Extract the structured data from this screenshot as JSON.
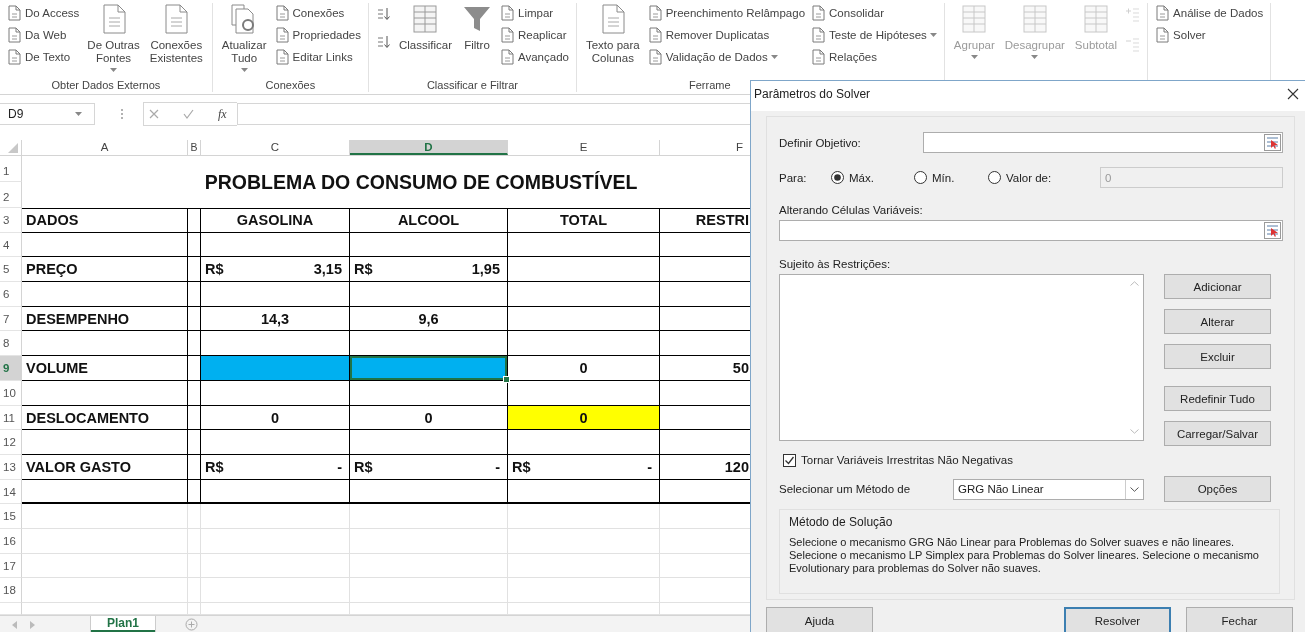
{
  "ribbon": {
    "groups": [
      {
        "label": "Obter Dados Externos",
        "controls": [
          {
            "kind": "stack",
            "disabled": false,
            "items": [
              {
                "label": "Do Access",
                "dropdown": false
              },
              {
                "label": "Da Web",
                "dropdown": false
              },
              {
                "label": "De Texto",
                "dropdown": false
              }
            ]
          },
          {
            "kind": "large",
            "disabled": false,
            "lines": [
              "De Outras",
              "Fontes"
            ],
            "dropdown": true
          },
          {
            "kind": "large",
            "disabled": false,
            "lines": [
              "Conexões",
              "Existentes"
            ],
            "dropdown": false
          }
        ]
      },
      {
        "label": "Conexões",
        "controls": [
          {
            "kind": "large",
            "disabled": false,
            "lines": [
              "Atualizar",
              "Tudo"
            ],
            "dropdown": true
          },
          {
            "kind": "stack",
            "disabled": false,
            "items": [
              {
                "label": "Conexões",
                "dropdown": false
              },
              {
                "label": "Propriedades",
                "dropdown": false
              },
              {
                "label": "Editar Links",
                "dropdown": false
              }
            ]
          }
        ]
      },
      {
        "label": "Classificar e Filtrar",
        "controls": [
          {
            "kind": "sort-buttons",
            "disabled": false
          },
          {
            "kind": "large",
            "disabled": false,
            "lines": [
              "Classificar"
            ],
            "dropdown": false
          },
          {
            "kind": "large",
            "disabled": false,
            "lines": [
              "Filtro"
            ],
            "dropdown": false
          },
          {
            "kind": "stack",
            "disabled": false,
            "items": [
              {
                "label": "Limpar",
                "dropdown": false
              },
              {
                "label": "Reaplicar",
                "dropdown": false
              },
              {
                "label": "Avançado",
                "dropdown": false
              }
            ]
          }
        ]
      },
      {
        "label": "Ferrame",
        "controls": [
          {
            "kind": "large",
            "disabled": false,
            "lines": [
              "Texto para",
              "Colunas"
            ],
            "dropdown": false
          },
          {
            "kind": "stack",
            "disabled": false,
            "items": [
              {
                "label": "Preenchimento Relâmpago",
                "dropdown": false
              },
              {
                "label": "Remover Duplicatas",
                "dropdown": false
              },
              {
                "label": "Validação de Dados",
                "dropdown": true
              }
            ]
          },
          {
            "kind": "stack",
            "disabled": false,
            "items": [
              {
                "label": "Consolidar",
                "dropdown": false
              },
              {
                "label": "Teste de Hipóteses",
                "dropdown": true
              },
              {
                "label": "Relações",
                "dropdown": false
              }
            ]
          }
        ]
      },
      {
        "controls": [
          {
            "kind": "large",
            "disabled": true,
            "lines": [
              "Agrupar"
            ],
            "dropdown": true
          },
          {
            "kind": "large",
            "disabled": true,
            "lines": [
              "Desagrupar"
            ],
            "dropdown": true
          },
          {
            "kind": "large",
            "disabled": true,
            "lines": [
              "Subtotal"
            ],
            "dropdown": false
          },
          {
            "kind": "outline-buttons",
            "disabled": true
          }
        ]
      },
      {
        "controls": [
          {
            "kind": "stack",
            "disabled": false,
            "items": [
              {
                "label": "Análise de Dados",
                "dropdown": false
              },
              {
                "label": "Solver",
                "dropdown": false
              }
            ]
          }
        ]
      }
    ]
  },
  "formula_bar": {
    "name_box": "D9",
    "function_label": "fx"
  },
  "sheet": {
    "title": "PROBLEMA DO CONSUMO DE COMBUSTÍVEL",
    "columns": [
      {
        "label": "A",
        "selected": false
      },
      {
        "label": "B",
        "selected": false
      },
      {
        "label": "C",
        "selected": false
      },
      {
        "label": "D",
        "selected": true
      },
      {
        "label": "E",
        "selected": false
      },
      {
        "label": "F",
        "selected": false
      }
    ],
    "title_rows": [
      {
        "number": "1",
        "selected": false
      },
      {
        "number": "2",
        "selected": false
      }
    ],
    "rows": [
      {
        "number": "3",
        "selected": false,
        "bordered": true,
        "cells": [
          {
            "kind": "label",
            "text": "DADOS",
            "selected": false
          },
          {
            "kind": "empty",
            "selected": false
          },
          {
            "kind": "center",
            "text": "GASOLINA",
            "selected": false
          },
          {
            "kind": "center",
            "text": "ALCOOL",
            "selected": false
          },
          {
            "kind": "center",
            "text": "TOTAL",
            "selected": false
          },
          {
            "kind": "right",
            "text": "RESTRI",
            "selected": false
          }
        ]
      },
      {
        "number": "4",
        "selected": false,
        "bordered": true
      },
      {
        "number": "5",
        "selected": false,
        "bordered": true,
        "cells": [
          {
            "kind": "label",
            "text": "PREÇO",
            "selected": false
          },
          {
            "kind": "empty",
            "selected": false
          },
          {
            "kind": "money",
            "currency": "R$",
            "amount": "3,15",
            "selected": false
          },
          {
            "kind": "money",
            "currency": "R$",
            "amount": "1,95",
            "selected": false
          },
          {
            "kind": "empty",
            "selected": false
          },
          {
            "kind": "empty",
            "selected": false
          }
        ]
      },
      {
        "number": "6",
        "selected": false,
        "bordered": true
      },
      {
        "number": "7",
        "selected": false,
        "bordered": true,
        "cells": [
          {
            "kind": "label",
            "text": "DESEMPENHO",
            "selected": false
          },
          {
            "kind": "empty",
            "selected": false
          },
          {
            "kind": "center",
            "text": "14,3",
            "selected": false
          },
          {
            "kind": "center",
            "text": "9,6",
            "selected": false
          },
          {
            "kind": "empty",
            "selected": false
          },
          {
            "kind": "empty",
            "selected": false
          }
        ]
      },
      {
        "number": "8",
        "selected": false,
        "bordered": true
      },
      {
        "number": "9",
        "selected": true,
        "bordered": true,
        "cells": [
          {
            "kind": "label",
            "text": "VOLUME",
            "selected": false
          },
          {
            "kind": "empty",
            "selected": false
          },
          {
            "kind": "empty",
            "color": "#00b0f0",
            "selected": false
          },
          {
            "kind": "empty",
            "color": "#00b0f0",
            "selected": true
          },
          {
            "kind": "center",
            "text": "0",
            "selected": false
          },
          {
            "kind": "right",
            "text": "50",
            "selected": false
          }
        ]
      },
      {
        "number": "10",
        "selected": false,
        "bordered": true
      },
      {
        "number": "11",
        "selected": false,
        "bordered": true,
        "cells": [
          {
            "kind": "label",
            "text": "DESLOCAMENTO",
            "selected": false
          },
          {
            "kind": "empty",
            "selected": false
          },
          {
            "kind": "center",
            "text": "0",
            "selected": false
          },
          {
            "kind": "center",
            "text": "0",
            "selected": false
          },
          {
            "kind": "center",
            "text": "0",
            "color": "#ffff00",
            "selected": false
          },
          {
            "kind": "empty",
            "selected": false
          }
        ]
      },
      {
        "number": "12",
        "selected": false,
        "bordered": true
      },
      {
        "number": "13",
        "selected": false,
        "bordered": true,
        "cells": [
          {
            "kind": "label",
            "text": "VALOR GASTO",
            "selected": false
          },
          {
            "kind": "empty",
            "selected": false
          },
          {
            "kind": "money",
            "currency": "R$",
            "amount": "-",
            "selected": false
          },
          {
            "kind": "money",
            "currency": "R$",
            "amount": "-",
            "selected": false
          },
          {
            "kind": "money",
            "currency": "R$",
            "amount": "-",
            "selected": false
          },
          {
            "kind": "right",
            "text": "120",
            "selected": false
          }
        ]
      },
      {
        "number": "14",
        "selected": false,
        "bordered": true
      },
      {
        "number": "15",
        "selected": false,
        "bordered": false
      },
      {
        "number": "16",
        "selected": false,
        "bordered": false
      },
      {
        "number": "17",
        "selected": false,
        "bordered": false
      },
      {
        "number": "18",
        "selected": false,
        "bordered": false
      }
    ]
  },
  "sheet_tabs": [
    {
      "label": "Plan1",
      "selected": true
    }
  ],
  "solver_dialog": {
    "title": "Parâmetros do Solver",
    "objective": {
      "label": "Definir Objetivo:"
    },
    "to": {
      "label": "Para:",
      "options": [
        {
          "label": "Máx.",
          "selected": true
        },
        {
          "label": "Mín.",
          "selected": false
        },
        {
          "label": "Valor de:",
          "selected": false
        }
      ],
      "value": "0",
      "value_disabled": true
    },
    "changing": {
      "label": "Alterando Células Variáveis:"
    },
    "constraints": {
      "label": "Sujeito às Restrições:"
    },
    "side_buttons": [
      "Adicionar",
      "Alterar",
      "Excluir",
      "Redefinir Tudo",
      "Carregar/Salvar"
    ],
    "nonnegative": {
      "label": "Tornar Variáveis Irrestritas Não Negativas",
      "checked": true
    },
    "method": {
      "label": "Selecionar um Método de",
      "value": "GRG Não Linear"
    },
    "options_button": "Opções",
    "solution": {
      "title": "Método de Solução",
      "text": "Selecione o mecanismo GRG Não Linear para Problemas do Solver suaves e não lineares. Selecione o mecanismo LP Simplex para Problemas do Solver lineares. Selecione o mecanismo Evolutionary para problemas do Solver não suaves."
    },
    "footer_buttons": [
      {
        "label": "Ajuda",
        "focused": false
      },
      {
        "label": "Resolver",
        "focused": true
      },
      {
        "label": "Fechar",
        "focused": false
      }
    ]
  }
}
